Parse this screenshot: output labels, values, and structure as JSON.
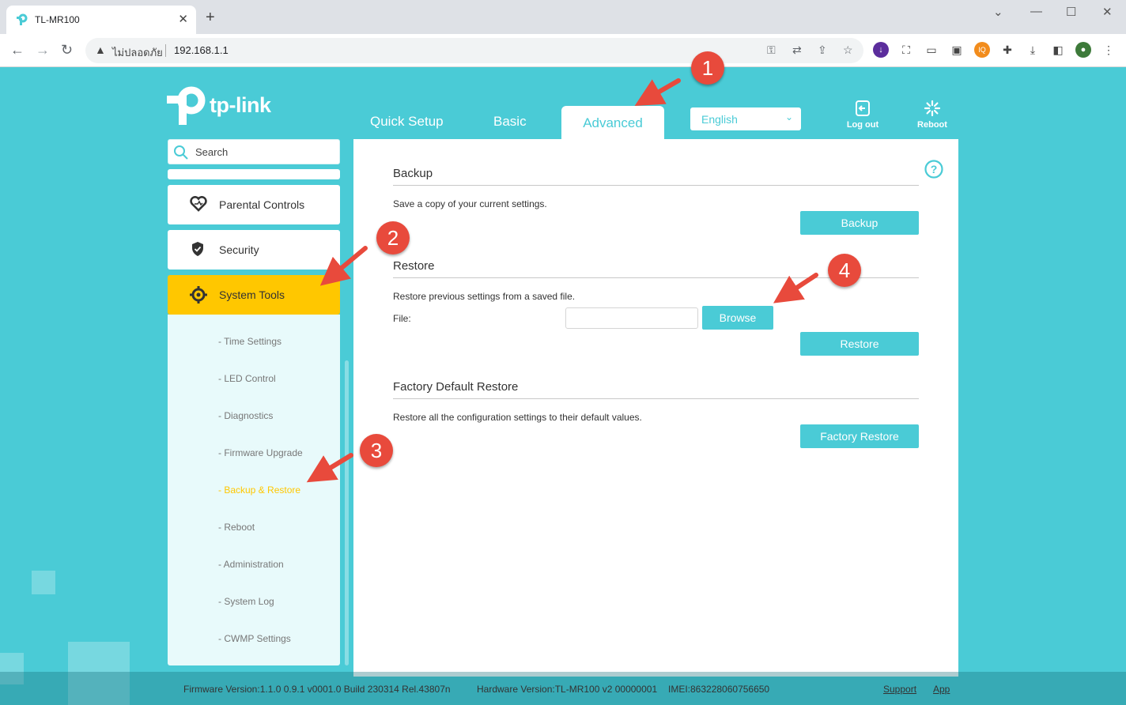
{
  "browser": {
    "tab_title": "TL-MR100",
    "security_label": "ไม่ปลอดภัย",
    "url": "192.168.1.1"
  },
  "router": {
    "logo_text": "tp-link",
    "tabs": [
      "Quick Setup",
      "Basic",
      "Advanced"
    ],
    "active_tab": "Advanced",
    "language": "English",
    "logout_label": "Log out",
    "reboot_label": "Reboot",
    "search_placeholder": "Search",
    "menu": [
      {
        "label": "Parental Controls",
        "icon": "heart-icon"
      },
      {
        "label": "Security",
        "icon": "shield-icon"
      },
      {
        "label": "System Tools",
        "icon": "gear-icon",
        "active": true
      }
    ],
    "submenu": [
      "- Time Settings",
      "- LED Control",
      "- Diagnostics",
      "- Firmware Upgrade",
      "- Backup & Restore",
      "- Reboot",
      "- Administration",
      "- System Log",
      "- CWMP Settings"
    ],
    "active_submenu": "- Backup & Restore"
  },
  "content": {
    "backup": {
      "title": "Backup",
      "desc": "Save a copy of your current settings.",
      "button": "Backup"
    },
    "restore": {
      "title": "Restore",
      "desc": "Restore previous settings from a saved file.",
      "file_label": "File:",
      "browse": "Browse",
      "button": "Restore"
    },
    "factory": {
      "title": "Factory Default Restore",
      "desc": "Restore all the configuration settings to their default values.",
      "button": "Factory Restore"
    }
  },
  "footer": {
    "firmware": "Firmware Version:1.1.0 0.9.1 v0001.0 Build 230314 Rel.43807n",
    "hardware": "Hardware Version:TL-MR100 v2 00000001",
    "imei": "IMEI:863228060756650",
    "support": "Support",
    "app": "App"
  },
  "annotations": [
    "1",
    "2",
    "3",
    "4"
  ],
  "colors": {
    "accent": "#4acbd6",
    "active_menu": "#ffc700",
    "badge": "#e84a3c"
  }
}
